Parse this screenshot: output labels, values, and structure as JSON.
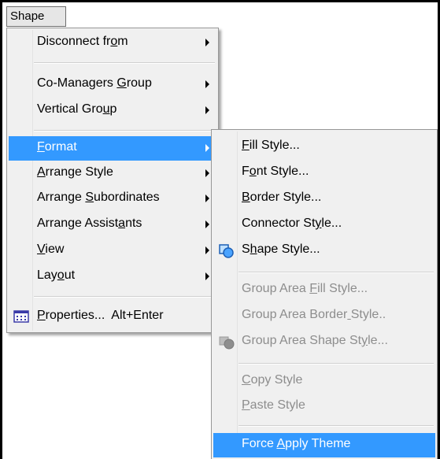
{
  "menubar": {
    "shape_label": "Shape"
  },
  "main_menu": {
    "items": [
      {
        "label": "Disconnect from",
        "mnemonic": 13
      },
      {
        "label": "Co-Managers Group",
        "mnemonic": 12
      },
      {
        "label": "Vertical Group",
        "mnemonic": 12
      },
      {
        "label": "Format",
        "mnemonic": 0
      },
      {
        "label": "Arrange Style",
        "mnemonic": 0
      },
      {
        "label": "Arrange Subordinates",
        "mnemonic": 8
      },
      {
        "label": "Arrange Assistants",
        "mnemonic": 14
      },
      {
        "label": "View",
        "mnemonic": 0
      },
      {
        "label": "Layout",
        "mnemonic": 3
      },
      {
        "label": "Properties...  Alt+Enter",
        "mnemonic": 0
      }
    ]
  },
  "sub_menu": {
    "items": [
      {
        "label": "Fill Style...",
        "mnemonic": 0
      },
      {
        "label": "Font Style...",
        "mnemonic": 1
      },
      {
        "label": "Border Style...",
        "mnemonic": 0
      },
      {
        "label": "Connector Style...",
        "mnemonic": 12
      },
      {
        "label": "Shape Style...",
        "mnemonic": 1
      },
      {
        "label": "Group Area Fill Style...",
        "mnemonic": 11
      },
      {
        "label": "Group Area Border Style..",
        "mnemonic": 17
      },
      {
        "label": "Group Area Shape Style...",
        "mnemonic": 19
      },
      {
        "label": "Copy Style",
        "mnemonic": 0
      },
      {
        "label": "Paste Style",
        "mnemonic": 0
      },
      {
        "label": "Force Apply Theme",
        "mnemonic": 6
      }
    ]
  },
  "colors": {
    "highlight": "#3399ff",
    "menu_bg": "#f0f0f0",
    "disabled_text": "#8d8d8d"
  }
}
